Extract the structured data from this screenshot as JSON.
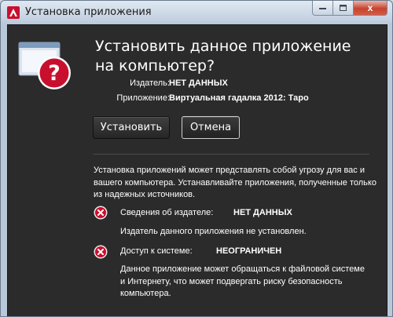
{
  "window": {
    "title": "Установка приложения",
    "close_glyph": "x",
    "icon": "adobe-air-icon"
  },
  "prompt": {
    "headline": "Установить данное приложение на компьютер?",
    "icon": "question-warning-icon"
  },
  "info": {
    "publisher_label": "Издатель:",
    "publisher_value": "НЕТ ДАННЫХ",
    "application_label": "Приложение:",
    "application_value": "Виртуальная гадалка 2012: Таро"
  },
  "buttons": {
    "install_label": "Установить",
    "cancel_label": "Отмена"
  },
  "warning": {
    "text": "Установка приложений может представлять собой угрозу для вас и вашего компьютера. Устанавливайте приложения, полученные только из надежных источников."
  },
  "details": [
    {
      "label": "Сведения об издателе:",
      "value": "НЕТ ДАННЫХ",
      "description": "Издатель данного приложения не установлен."
    },
    {
      "label": "Доступ к системе:",
      "value": "НЕОГРАНИЧЕН",
      "description": "Данное приложение может обращаться к файловой системе и Интернету, что может подвергать риску безопасность компьютера."
    }
  ],
  "colors": {
    "dialog_background": "#2b2b2b",
    "error_red": "#c8102e",
    "text": "#ffffff"
  }
}
